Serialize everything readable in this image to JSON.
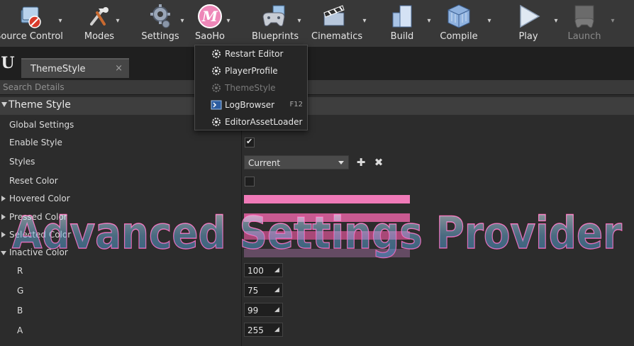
{
  "toolbar": {
    "items": [
      {
        "label": "Source Control",
        "icon": "source-control-icon"
      },
      {
        "label": "Modes",
        "icon": "modes-icon"
      },
      {
        "label": "Settings",
        "icon": "settings-gear-icon"
      },
      {
        "label": "SaoHo",
        "icon": "saoho-m-icon"
      },
      {
        "label": "Blueprints",
        "icon": "blueprints-gamepad-icon"
      },
      {
        "label": "Cinematics",
        "icon": "cinematics-clapper-icon"
      },
      {
        "label": "Build",
        "icon": "build-blocks-icon"
      },
      {
        "label": "Compile",
        "icon": "compile-cube-icon"
      },
      {
        "label": "Play",
        "icon": "play-icon"
      },
      {
        "label": "Launch",
        "icon": "launch-icon",
        "disabled": true
      }
    ]
  },
  "tab": {
    "label": "ThemeStyle",
    "close": "×",
    "logo": "U"
  },
  "search": {
    "placeholder": "Search Details"
  },
  "category": {
    "label": "Theme Style"
  },
  "properties": {
    "global_settings": "Global Settings",
    "enable_style": "Enable Style",
    "enable_style_checked": true,
    "styles": "Styles",
    "styles_value": "Current",
    "reset_color": "Reset Color",
    "reset_color_checked": false,
    "hovered_color": "Hovered Color",
    "pressed_color": "Pressed Color",
    "selected_color": "Selected Color",
    "inactive_color": "Inactive Color",
    "r": "R",
    "r_value": "100",
    "g": "G",
    "g_value": "75",
    "b": "B",
    "b_value": "99",
    "a": "A",
    "a_value": "255"
  },
  "colors": {
    "hovered": "#f07ab8",
    "pressed": "#c95a91",
    "selected": "#a84877",
    "inactive": "#644b63"
  },
  "menu": {
    "items": [
      {
        "label": "Restart Editor",
        "icon": "gear-icon",
        "shortcut": ""
      },
      {
        "label": "PlayerProfile",
        "icon": "gear-icon",
        "shortcut": ""
      },
      {
        "label": "ThemeStyle",
        "icon": "gear-icon",
        "shortcut": "",
        "disabled": true
      },
      {
        "label": "LogBrowser",
        "icon": "log-terminal-icon",
        "shortcut": "F12"
      },
      {
        "label": "EditorAssetLoader",
        "icon": "gear-icon",
        "shortcut": ""
      }
    ]
  },
  "watermark": {
    "text": "Advanced Settings Provider"
  }
}
